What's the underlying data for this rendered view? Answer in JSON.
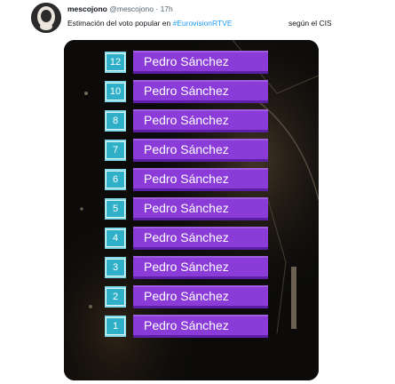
{
  "tweet": {
    "display_name": "mescojono",
    "handle": "@mescojono",
    "separator": "·",
    "time": "17h",
    "text_before": "Estimación del voto popular en",
    "hashtag": "#EurovisionRTVE",
    "text_after": "según el CIS"
  },
  "scoreboard": {
    "rows": [
      {
        "rank": "12",
        "name": "Pedro Sánchez"
      },
      {
        "rank": "10",
        "name": "Pedro Sánchez"
      },
      {
        "rank": "8",
        "name": "Pedro Sánchez"
      },
      {
        "rank": "7",
        "name": "Pedro Sánchez"
      },
      {
        "rank": "6",
        "name": "Pedro Sánchez"
      },
      {
        "rank": "5",
        "name": "Pedro Sánchez"
      },
      {
        "rank": "4",
        "name": "Pedro Sánchez"
      },
      {
        "rank": "3",
        "name": "Pedro Sánchez"
      },
      {
        "rank": "2",
        "name": "Pedro Sánchez"
      },
      {
        "rank": "1",
        "name": "Pedro Sánchez"
      }
    ]
  },
  "colors": {
    "hashtag": "#1d9bf0",
    "rank_box": "#2fb0c8",
    "name_box": "#8a3bd8"
  },
  "icons": {
    "avatar": "profile-avatar"
  }
}
